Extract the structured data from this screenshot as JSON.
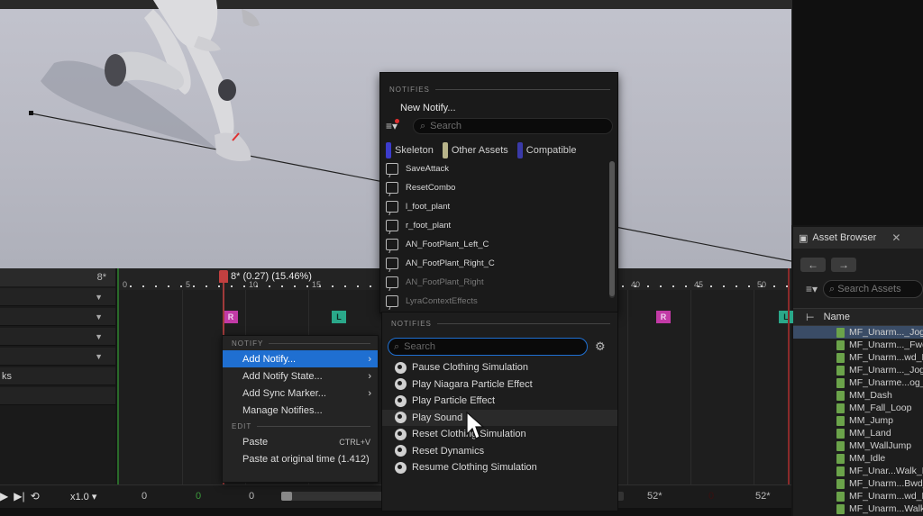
{
  "timeline": {
    "current_frame": "8* (0.27) (15.46%)",
    "track_frame_label": "8*",
    "ticks": [
      "0",
      "5",
      "10",
      "15",
      "40",
      "45",
      "50"
    ],
    "notify_tags": [
      {
        "text": "R",
        "kind": "right"
      },
      {
        "text": "L",
        "kind": "left"
      },
      {
        "text": "R",
        "kind": "right"
      },
      {
        "text": "L",
        "kind": "left"
      }
    ]
  },
  "tracks": {
    "partial_label": "ks"
  },
  "transport": {
    "speed": "x1.0",
    "fields": [
      "0",
      "0",
      "0",
      "52*",
      "0",
      "52*"
    ]
  },
  "context_menu": {
    "notify_header": "NOTIFY",
    "edit_header": "EDIT",
    "items": [
      {
        "label": "Add Notify...",
        "has_submenu": true,
        "highlighted": true
      },
      {
        "label": "Add Notify State...",
        "has_submenu": true
      },
      {
        "label": "Add Sync Marker...",
        "has_submenu": true
      },
      {
        "label": "Manage Notifies...",
        "has_submenu": false
      }
    ],
    "edit_items": [
      {
        "label": "Paste",
        "shortcut": "CTRL+V"
      },
      {
        "label": "Paste at original time (1.412)",
        "shortcut": ""
      }
    ]
  },
  "notify_popup": {
    "header": "NOTIFIES",
    "new_notify": "New Notify...",
    "search_placeholder": "Search",
    "tabs": [
      {
        "label": "Skeleton",
        "color": "#3c3ccc"
      },
      {
        "label": "Other Assets",
        "color": "#b8b48a"
      },
      {
        "label": "Compatible",
        "color": "#3a3aa8"
      }
    ],
    "items": [
      "SaveAttack",
      "ResetCombo",
      "l_foot_plant",
      "r_foot_plant",
      "AN_FootPlant_Left_C",
      "AN_FootPlant_Right_C",
      "AN_FootPlant_Right",
      "LyraContextEffects"
    ]
  },
  "notifies_bottom": {
    "header": "NOTIFIES",
    "search_placeholder": "Search",
    "items": [
      "Pause Clothing Simulation",
      "Play Niagara Particle Effect",
      "Play Particle Effect",
      "Play Sound",
      "Reset Clothing Simulation",
      "Reset Dynamics",
      "Resume Clothing Simulation"
    ]
  },
  "asset_browser": {
    "title": "Asset Browser",
    "search_placeholder": "Search Assets",
    "column_name": "Name",
    "items": [
      "MF_Unarm..._Jog",
      "MF_Unarm..._Fwd",
      "MF_Unarm...wd_R",
      "MF_Unarm..._Jog",
      "MF_Unarme...og_l",
      "MM_Dash",
      "MM_Fall_Loop",
      "MM_Jump",
      "MM_Land",
      "MM_WallJump",
      "MM_Idle",
      "MF_Unar...Walk_B",
      "MF_Unarm...Bwd_",
      "MF_Unarm...wd_R",
      "MF_Unarm...Walk"
    ]
  }
}
